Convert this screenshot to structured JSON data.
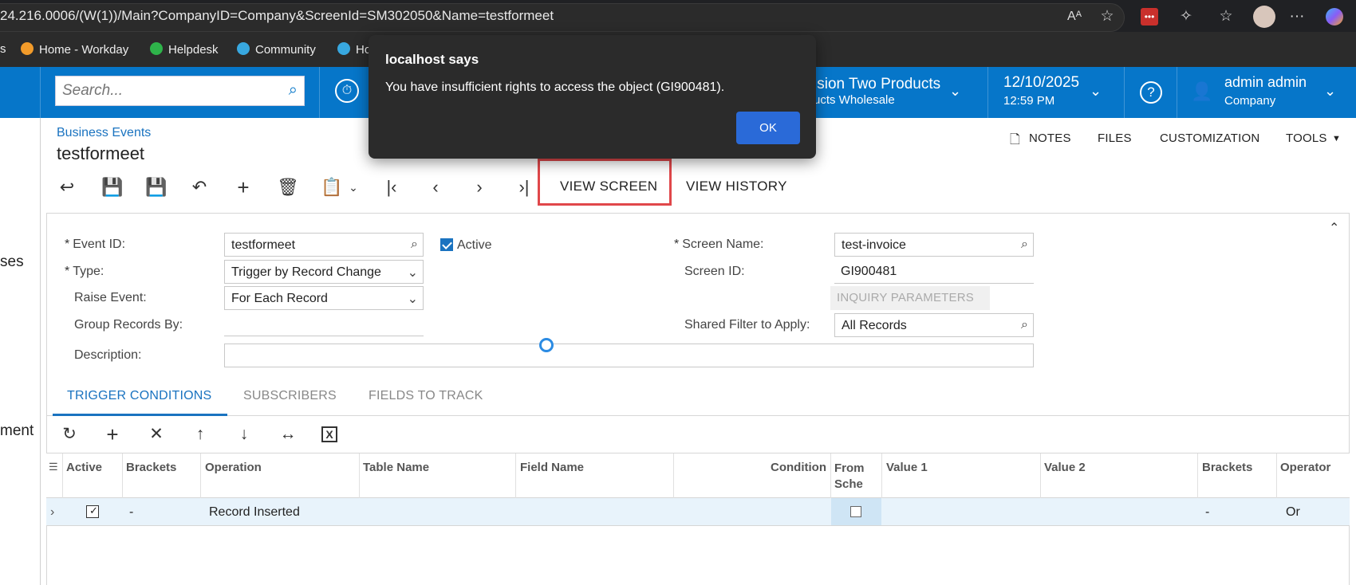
{
  "browser": {
    "url": "24.216.0006/(W(1))/Main?CompanyID=Company&ScreenId=SM302050&Name=testformeet",
    "bookmarks": [
      {
        "label": "s"
      },
      {
        "label": "Home - Workday"
      },
      {
        "label": "Helpdesk"
      },
      {
        "label": "Community"
      },
      {
        "label": "Ho"
      }
    ]
  },
  "header": {
    "search_placeholder": "Search...",
    "branch_line1": "ision Two Products",
    "branch_line2": "ucts Wholesale",
    "date": "12/10/2025",
    "time": "12:59 PM",
    "user_name": "admin admin",
    "user_company": "Company",
    "help": "?"
  },
  "leftnav": {
    "item1": "ses",
    "item2": "ment"
  },
  "page": {
    "breadcrumb": "Business Events",
    "title": "testformeet",
    "top_actions": {
      "notes": "NOTES",
      "files": "FILES",
      "customization": "CUSTOMIZATION",
      "tools": "TOOLS"
    },
    "toolbar": {
      "view_screen": "VIEW SCREEN",
      "view_history": "VIEW HISTORY"
    }
  },
  "form": {
    "event_id_label": "Event ID:",
    "event_id_value": "testformeet",
    "active_label": "Active",
    "active_checked": true,
    "type_label": "Type:",
    "type_value": "Trigger by Record Change",
    "raise_event_label": "Raise Event:",
    "raise_event_value": "For Each Record",
    "group_records_label": "Group Records By:",
    "description_label": "Description:",
    "screen_name_label": "Screen Name:",
    "screen_name_value": "test-invoice",
    "screen_id_label": "Screen ID:",
    "screen_id_value": "GI900481",
    "inquiry_params": "INQUIRY PARAMETERS",
    "shared_filter_label": "Shared Filter to Apply:",
    "shared_filter_value": "All Records"
  },
  "tabs": [
    {
      "label": "TRIGGER CONDITIONS",
      "active": true
    },
    {
      "label": "SUBSCRIBERS",
      "active": false
    },
    {
      "label": "FIELDS TO TRACK",
      "active": false
    }
  ],
  "grid": {
    "columns": [
      "Active",
      "Brackets",
      "Operation",
      "Table Name",
      "Field Name",
      "Condition",
      "From Sche",
      "Value 1",
      "Value 2",
      "Brackets",
      "Operator"
    ],
    "rows": [
      {
        "active": true,
        "brackets_open": "-",
        "operation": "Record Inserted",
        "table_name": "",
        "field_name": "",
        "condition": "",
        "from_schema": false,
        "value1": "",
        "value2": "",
        "brackets_close": "-",
        "operator": "Or"
      }
    ]
  },
  "dialog": {
    "title": "localhost says",
    "message": "You have insufficient rights to access the object (GI900481).",
    "ok_label": "OK"
  },
  "colors": {
    "header_blue": "#0676c9",
    "accent": "#1a73c0",
    "highlight_box": "#e0474a",
    "dialog_bg": "#2b2b2b",
    "ok_button": "#2a6ad8"
  }
}
